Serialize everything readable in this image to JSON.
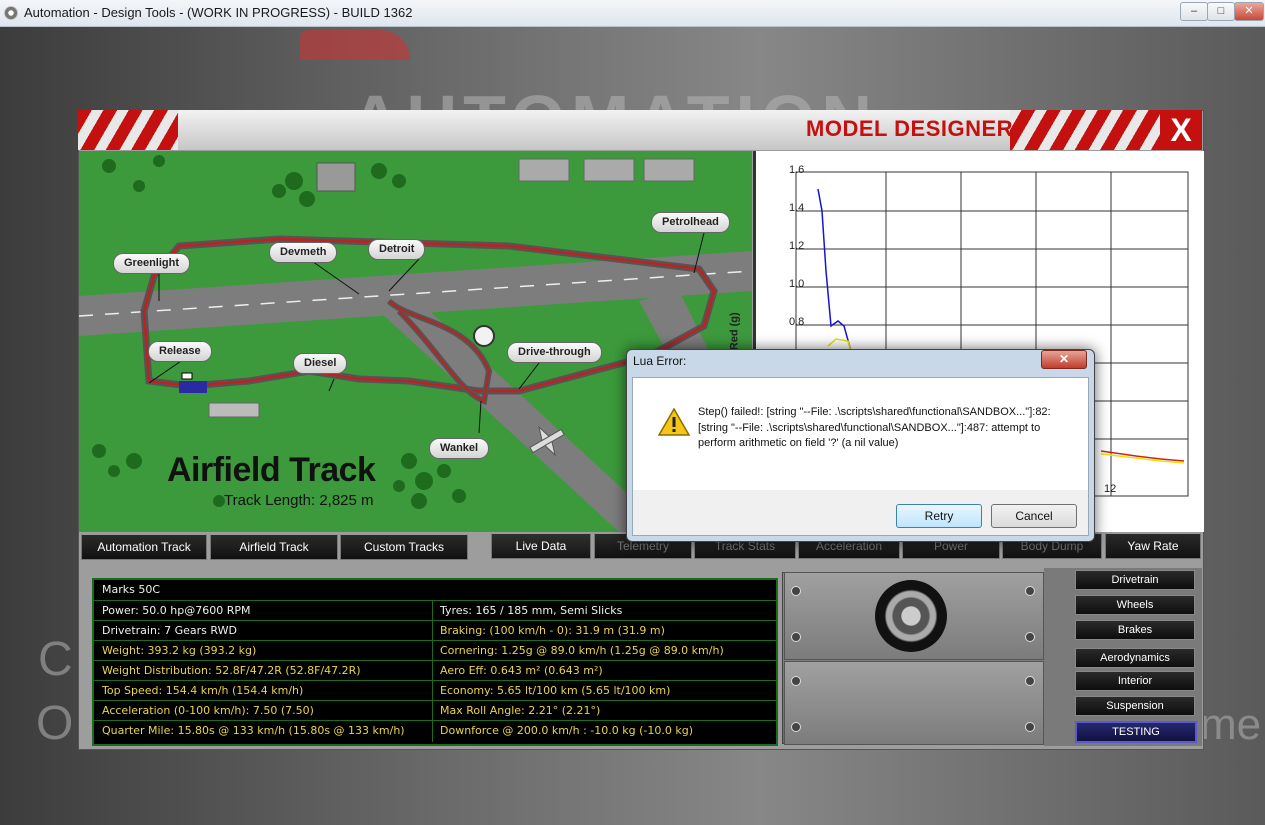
{
  "window": {
    "title": "Automation - Design Tools - (WORK IN PROGRESS) - BUILD 1362",
    "minimize": "–",
    "maximize": "□",
    "close": "✕"
  },
  "background": {
    "logo_text": "AUTOMATION",
    "left_letter_1": "C",
    "left_letter_2": "O",
    "right_text": "me"
  },
  "header": {
    "title": "MODEL DESIGNER",
    "close": "X"
  },
  "map": {
    "track_name": "Airfield Track",
    "track_length": "Track Length: 2,825 m",
    "corners": [
      "Greenlight",
      "Devmeth",
      "Detroit",
      "Petrolhead",
      "Release",
      "Diesel",
      "Drive-through",
      "Wankel"
    ]
  },
  "graph": {
    "ylabel": "wer: Blue; Tyres: Red (g)",
    "yticks": [
      "1.6",
      "1.4",
      "1.2",
      "1.0",
      "0.8"
    ],
    "xtick_visible": "12"
  },
  "track_tabs": [
    "Automation Track",
    "Airfield Track",
    "Custom Tracks"
  ],
  "data_tabs": [
    "Live Data",
    "Telemetry",
    "Track Stats",
    "Acceleration",
    "Power",
    "Body Dump",
    "Yaw Rate"
  ],
  "stats": {
    "car_name": "Marks 50C",
    "rows": [
      {
        "left": "Power: 50.0 hp@7600 RPM",
        "left_color": "white",
        "right": "Tyres: 165 / 185 mm, Semi Slicks",
        "right_color": "white"
      },
      {
        "left": "Drivetrain: 7 Gears RWD",
        "left_color": "white",
        "right": "Braking: (100 km/h - 0): 31.9 m (31.9 m)",
        "right_color": "yellow"
      },
      {
        "left": "Weight: 393.2 kg (393.2 kg)",
        "left_color": "yellow",
        "right": "Cornering: 1.25g @ 89.0 km/h (1.25g @ 89.0 km/h)",
        "right_color": "yellow"
      },
      {
        "left": "Weight Distribution: 52.8F/47.2R (52.8F/47.2R)",
        "left_color": "yellow",
        "right": "Aero Eff: 0.643 m² (0.643 m²)",
        "right_color": "yellow"
      },
      {
        "left": "Top Speed: 154.4 km/h (154.4 km/h)",
        "left_color": "yellow",
        "right": "Economy: 5.65 lt/100 km (5.65 lt/100 km)",
        "right_color": "yellow"
      },
      {
        "left": "Acceleration (0-100 km/h): 7.50 (7.50)",
        "left_color": "yellow",
        "right": "Max Roll Angle: 2.21° (2.21°)",
        "right_color": "yellow"
      },
      {
        "left": "Quarter Mile: 15.80s @ 133 km/h (15.80s @ 133 km/h)",
        "left_color": "yellow",
        "right": "Downforce @ 200.0 km/h : -10.0 kg (-10.0 kg)",
        "right_color": "yellow"
      }
    ]
  },
  "sidebar": {
    "items": [
      "Drivetrain",
      "Wheels",
      "Brakes",
      "Aerodynamics",
      "Interior",
      "Suspension",
      "TESTING"
    ]
  },
  "dialog": {
    "title": "Lua Error:",
    "message": "Step() failed!: [string \"--File: .\\scripts\\shared\\functional\\SANDBOX...\"]:82: [string \"--File: .\\scripts\\shared\\functional\\SANDBOX...\"]:487: attempt to perform arithmetic on field '?' (a nil value)",
    "retry": "Retry",
    "cancel": "Cancel",
    "close": "✕"
  },
  "colors": {
    "brand_red": "#c51010",
    "stat_yellow": "#e8d44a",
    "grass": "#3c9a3c",
    "track_line": "#c02020"
  }
}
